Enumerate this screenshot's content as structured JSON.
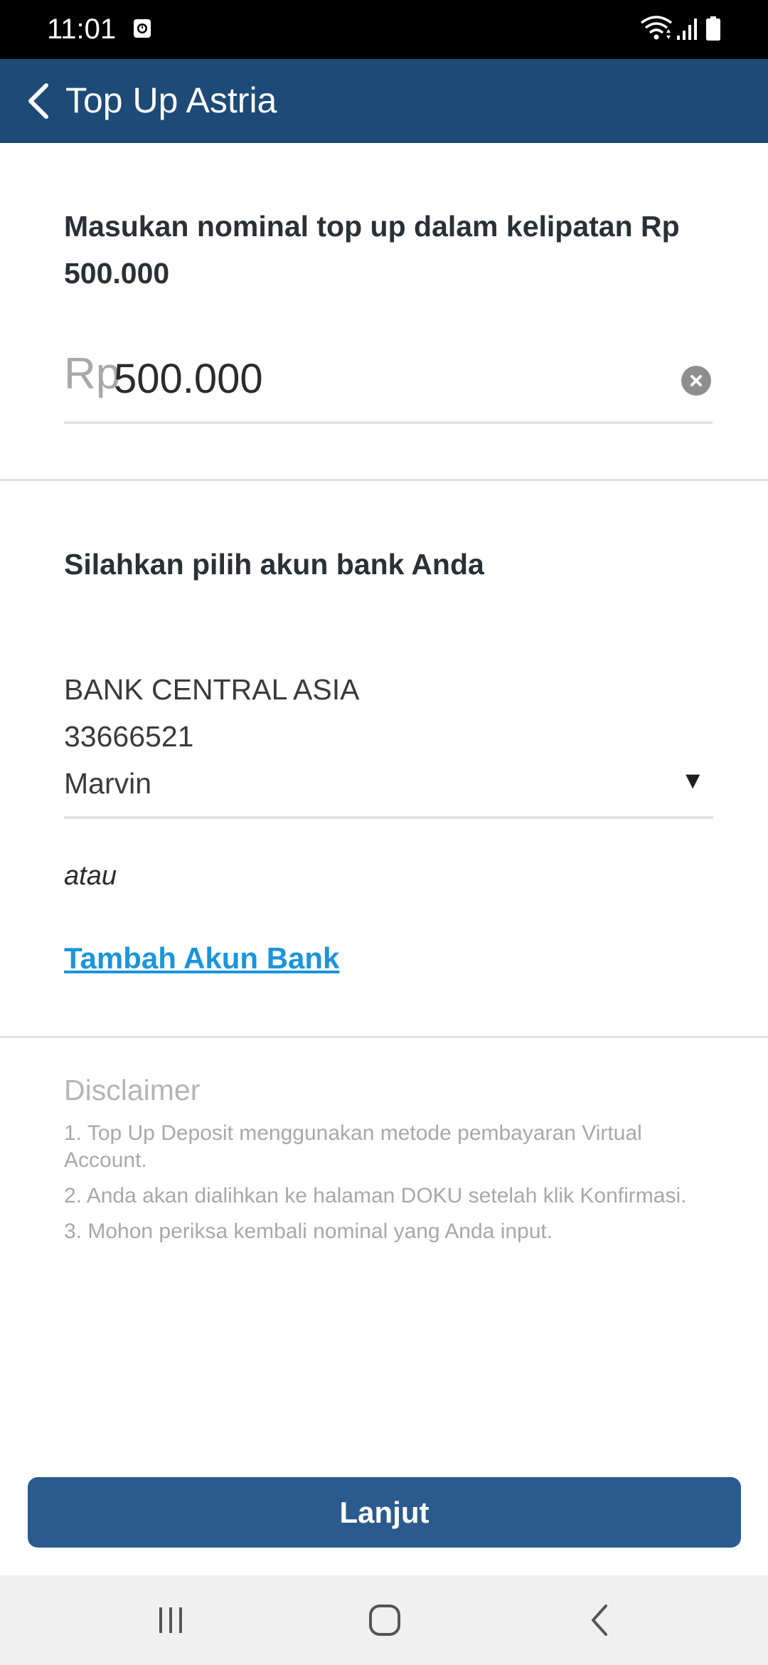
{
  "status_bar": {
    "time": "11:01"
  },
  "header": {
    "title": "Top Up Astria",
    "back_icon": "chevron-left-icon",
    "background_color": "#1e4a78"
  },
  "amount_section": {
    "label": "Masukan nominal top up dalam kelipatan Rp 500.000",
    "currency_prefix": "Rp",
    "value": "500.000"
  },
  "bank_section": {
    "heading": "Silahkan pilih akun bank Anda",
    "selected_bank": {
      "bank_name": "BANK CENTRAL ASIA",
      "account_number": "33666521",
      "account_holder": "Marvin"
    },
    "dropdown_caret": "▼",
    "or_text": "atau",
    "add_bank_link": "Tambah Akun Bank",
    "link_color": "#1a95dc"
  },
  "disclaimer": {
    "title": "Disclaimer",
    "items": [
      "1. Top Up Deposit menggunakan metode pembayaran Virtual Account.",
      "2. Anda akan dialihkan ke halaman DOKU setelah klik Konfirmasi.",
      "3. Mohon periksa kembali nominal yang Anda input."
    ]
  },
  "primary_button": {
    "label": "Lanjut",
    "color": "#2b5b8e"
  },
  "nav_bar": {
    "buttons": [
      "recent-apps-icon",
      "home-icon",
      "back-icon"
    ]
  }
}
